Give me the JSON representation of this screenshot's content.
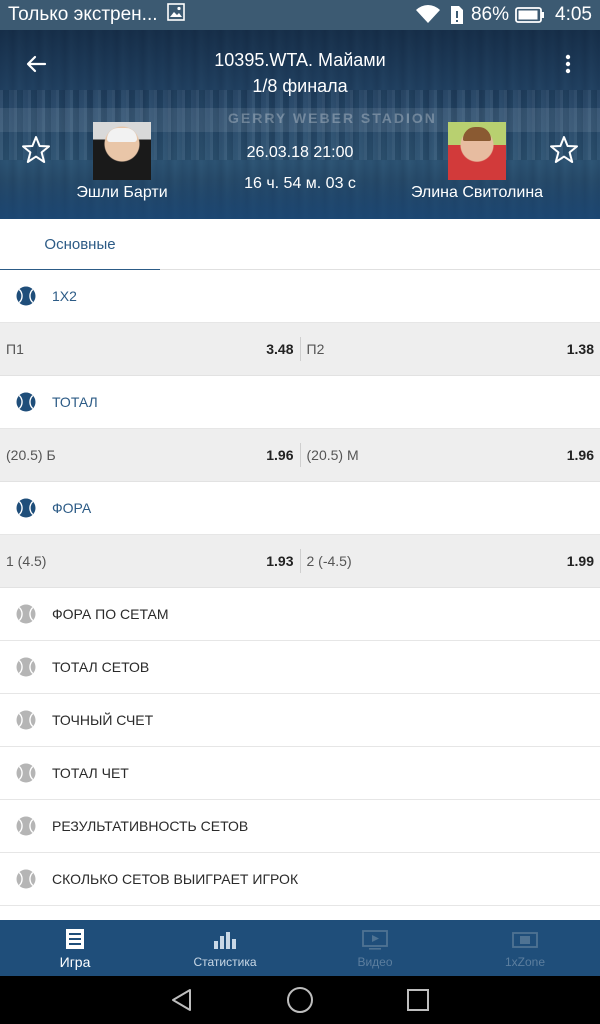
{
  "status_bar": {
    "notification_text": "Только экстрен...",
    "battery_percent": "86%",
    "time": "4:05"
  },
  "header": {
    "league": "10395.WTA. Майами",
    "stage": "1/8 финала",
    "date": "26.03.18 21:00",
    "countdown": "16 ч. 54 м. 03 с",
    "banner_text": "GERRY WEBER STADION",
    "player1": {
      "name": "Эшли Барти"
    },
    "player2": {
      "name": "Элина Свитолина"
    }
  },
  "tabs": [
    {
      "label": "Основные",
      "active": true
    }
  ],
  "markets": [
    {
      "title": "1X2",
      "expanded": true,
      "odds": [
        {
          "label": "П1",
          "value": "3.48"
        },
        {
          "label": "П2",
          "value": "1.38"
        }
      ]
    },
    {
      "title": "ТОТАЛ",
      "expanded": true,
      "odds": [
        {
          "label": "(20.5) Б",
          "value": "1.96"
        },
        {
          "label": "(20.5) М",
          "value": "1.96"
        }
      ]
    },
    {
      "title": "ФОРА",
      "expanded": true,
      "odds": [
        {
          "label": "1 (4.5)",
          "value": "1.93"
        },
        {
          "label": "2 (-4.5)",
          "value": "1.99"
        }
      ]
    },
    {
      "title": "ФОРА ПО СЕТАМ",
      "expanded": false
    },
    {
      "title": "ТОТАЛ СЕТОВ",
      "expanded": false
    },
    {
      "title": "ТОЧНЫЙ СЧЕТ",
      "expanded": false
    },
    {
      "title": "ТОТАЛ ЧЕТ",
      "expanded": false
    },
    {
      "title": "РЕЗУЛЬТАТИВНОСТЬ СЕТОВ",
      "expanded": false
    },
    {
      "title": "СКОЛЬКО СЕТОВ ВЫИГРАЕТ ИГРОК",
      "expanded": false
    }
  ],
  "bottom_nav": [
    {
      "label": "Игра",
      "icon": "game-icon",
      "state": "active"
    },
    {
      "label": "Статистика",
      "icon": "statistics-icon",
      "state": "normal"
    },
    {
      "label": "Видео",
      "icon": "video-icon",
      "state": "disabled"
    },
    {
      "label": "1xZone",
      "icon": "zone-icon",
      "state": "disabled"
    }
  ],
  "colors": {
    "status_bar": "#3c5a72",
    "accent_blue": "#2c5b86",
    "bottom_nav": "#1f4e7a",
    "odds_row_bg": "#eeeeee"
  }
}
